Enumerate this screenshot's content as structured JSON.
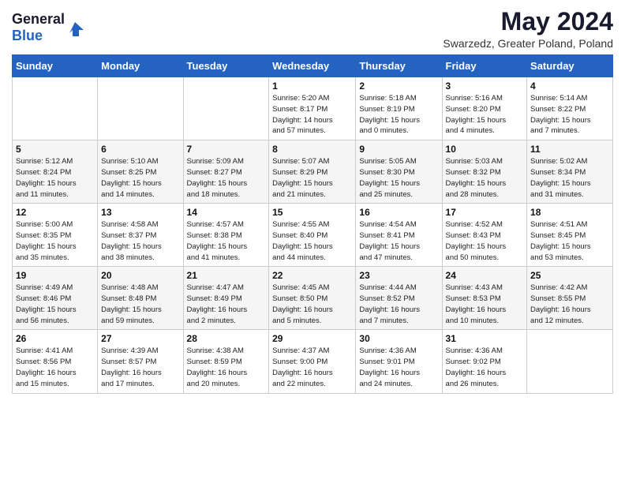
{
  "logo": {
    "general": "General",
    "blue": "Blue"
  },
  "title": "May 2024",
  "subtitle": "Swarzedz, Greater Poland, Poland",
  "days_of_week": [
    "Sunday",
    "Monday",
    "Tuesday",
    "Wednesday",
    "Thursday",
    "Friday",
    "Saturday"
  ],
  "weeks": [
    [
      {
        "day": "",
        "info": ""
      },
      {
        "day": "",
        "info": ""
      },
      {
        "day": "",
        "info": ""
      },
      {
        "day": "1",
        "info": "Sunrise: 5:20 AM\nSunset: 8:17 PM\nDaylight: 14 hours\nand 57 minutes."
      },
      {
        "day": "2",
        "info": "Sunrise: 5:18 AM\nSunset: 8:19 PM\nDaylight: 15 hours\nand 0 minutes."
      },
      {
        "day": "3",
        "info": "Sunrise: 5:16 AM\nSunset: 8:20 PM\nDaylight: 15 hours\nand 4 minutes."
      },
      {
        "day": "4",
        "info": "Sunrise: 5:14 AM\nSunset: 8:22 PM\nDaylight: 15 hours\nand 7 minutes."
      }
    ],
    [
      {
        "day": "5",
        "info": "Sunrise: 5:12 AM\nSunset: 8:24 PM\nDaylight: 15 hours\nand 11 minutes."
      },
      {
        "day": "6",
        "info": "Sunrise: 5:10 AM\nSunset: 8:25 PM\nDaylight: 15 hours\nand 14 minutes."
      },
      {
        "day": "7",
        "info": "Sunrise: 5:09 AM\nSunset: 8:27 PM\nDaylight: 15 hours\nand 18 minutes."
      },
      {
        "day": "8",
        "info": "Sunrise: 5:07 AM\nSunset: 8:29 PM\nDaylight: 15 hours\nand 21 minutes."
      },
      {
        "day": "9",
        "info": "Sunrise: 5:05 AM\nSunset: 8:30 PM\nDaylight: 15 hours\nand 25 minutes."
      },
      {
        "day": "10",
        "info": "Sunrise: 5:03 AM\nSunset: 8:32 PM\nDaylight: 15 hours\nand 28 minutes."
      },
      {
        "day": "11",
        "info": "Sunrise: 5:02 AM\nSunset: 8:34 PM\nDaylight: 15 hours\nand 31 minutes."
      }
    ],
    [
      {
        "day": "12",
        "info": "Sunrise: 5:00 AM\nSunset: 8:35 PM\nDaylight: 15 hours\nand 35 minutes."
      },
      {
        "day": "13",
        "info": "Sunrise: 4:58 AM\nSunset: 8:37 PM\nDaylight: 15 hours\nand 38 minutes."
      },
      {
        "day": "14",
        "info": "Sunrise: 4:57 AM\nSunset: 8:38 PM\nDaylight: 15 hours\nand 41 minutes."
      },
      {
        "day": "15",
        "info": "Sunrise: 4:55 AM\nSunset: 8:40 PM\nDaylight: 15 hours\nand 44 minutes."
      },
      {
        "day": "16",
        "info": "Sunrise: 4:54 AM\nSunset: 8:41 PM\nDaylight: 15 hours\nand 47 minutes."
      },
      {
        "day": "17",
        "info": "Sunrise: 4:52 AM\nSunset: 8:43 PM\nDaylight: 15 hours\nand 50 minutes."
      },
      {
        "day": "18",
        "info": "Sunrise: 4:51 AM\nSunset: 8:45 PM\nDaylight: 15 hours\nand 53 minutes."
      }
    ],
    [
      {
        "day": "19",
        "info": "Sunrise: 4:49 AM\nSunset: 8:46 PM\nDaylight: 15 hours\nand 56 minutes."
      },
      {
        "day": "20",
        "info": "Sunrise: 4:48 AM\nSunset: 8:48 PM\nDaylight: 15 hours\nand 59 minutes."
      },
      {
        "day": "21",
        "info": "Sunrise: 4:47 AM\nSunset: 8:49 PM\nDaylight: 16 hours\nand 2 minutes."
      },
      {
        "day": "22",
        "info": "Sunrise: 4:45 AM\nSunset: 8:50 PM\nDaylight: 16 hours\nand 5 minutes."
      },
      {
        "day": "23",
        "info": "Sunrise: 4:44 AM\nSunset: 8:52 PM\nDaylight: 16 hours\nand 7 minutes."
      },
      {
        "day": "24",
        "info": "Sunrise: 4:43 AM\nSunset: 8:53 PM\nDaylight: 16 hours\nand 10 minutes."
      },
      {
        "day": "25",
        "info": "Sunrise: 4:42 AM\nSunset: 8:55 PM\nDaylight: 16 hours\nand 12 minutes."
      }
    ],
    [
      {
        "day": "26",
        "info": "Sunrise: 4:41 AM\nSunset: 8:56 PM\nDaylight: 16 hours\nand 15 minutes."
      },
      {
        "day": "27",
        "info": "Sunrise: 4:39 AM\nSunset: 8:57 PM\nDaylight: 16 hours\nand 17 minutes."
      },
      {
        "day": "28",
        "info": "Sunrise: 4:38 AM\nSunset: 8:59 PM\nDaylight: 16 hours\nand 20 minutes."
      },
      {
        "day": "29",
        "info": "Sunrise: 4:37 AM\nSunset: 9:00 PM\nDaylight: 16 hours\nand 22 minutes."
      },
      {
        "day": "30",
        "info": "Sunrise: 4:36 AM\nSunset: 9:01 PM\nDaylight: 16 hours\nand 24 minutes."
      },
      {
        "day": "31",
        "info": "Sunrise: 4:36 AM\nSunset: 9:02 PM\nDaylight: 16 hours\nand 26 minutes."
      },
      {
        "day": "",
        "info": ""
      }
    ]
  ]
}
